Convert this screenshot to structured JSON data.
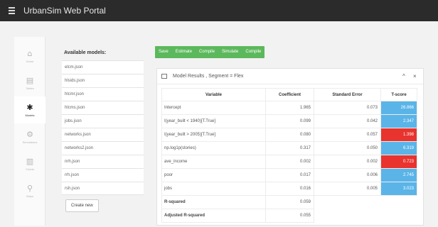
{
  "app": {
    "title": "UrbanSim Web Portal"
  },
  "sidebar": {
    "items": [
      {
        "icon": "home-icon",
        "glyph": "⌂",
        "label": "Home"
      },
      {
        "icon": "tables-icon",
        "glyph": "▤",
        "label": "Tables"
      },
      {
        "icon": "gear-icon",
        "glyph": "✱",
        "label": "Models"
      },
      {
        "icon": "simulations-icon",
        "glyph": "⚙",
        "label": "Simulations"
      },
      {
        "icon": "charts-icon",
        "glyph": "▥",
        "label": "Charts"
      },
      {
        "icon": "map-pin-icon",
        "glyph": "⚲",
        "label": "Maps"
      }
    ],
    "active": "Models"
  },
  "models": {
    "title": "Available models:",
    "items": [
      "elcm.json",
      "hlsids.json",
      "hlcmr.json",
      "hlcms.json",
      "jobs.json",
      "networks.json",
      "networks2.json",
      "nrh.json",
      "rrh.json",
      "rsh.json"
    ],
    "create_label": "Create new"
  },
  "toolbar": {
    "buttons": [
      "Save",
      "Estimate",
      "Compile",
      "Simulate",
      "Compile"
    ]
  },
  "results": {
    "title": "Model Results , Segment = Flex",
    "collapse": "^",
    "close": "×",
    "columns": [
      "Variable",
      "Coefficient",
      "Standard Error",
      "T-score"
    ],
    "rows": [
      {
        "variable": "Intercept",
        "coef": "1.965",
        "se": "0.073",
        "t": "26.866",
        "sign": "pos"
      },
      {
        "variable": "I(year_built < 1940)[T.True]",
        "coef": "0.099",
        "se": "0.042",
        "t": "2.347",
        "sign": "pos"
      },
      {
        "variable": "I(year_built > 2005)[T.True]",
        "coef": "0.080",
        "se": "0.057",
        "t": "1.398",
        "sign": "neg"
      },
      {
        "variable": "np.log1p(stories)",
        "coef": "0.317",
        "se": "0.050",
        "t": "6.319",
        "sign": "pos"
      },
      {
        "variable": "ave_income",
        "coef": "0.002",
        "se": "0.002",
        "t": "0.723",
        "sign": "neg"
      },
      {
        "variable": "poor",
        "coef": "0.017",
        "se": "0.006",
        "t": "2.745",
        "sign": "pos"
      },
      {
        "variable": "jobs",
        "coef": "0.016",
        "se": "0.005",
        "t": "3.023",
        "sign": "pos"
      }
    ],
    "stats": [
      {
        "label": "R-squared",
        "value": "0.059"
      },
      {
        "label": "Adjusted R-squared",
        "value": "0.055"
      }
    ]
  },
  "colors": {
    "positive": "#5ab4e8",
    "negative": "#e8332e",
    "toolbar": "#5cb85c"
  }
}
